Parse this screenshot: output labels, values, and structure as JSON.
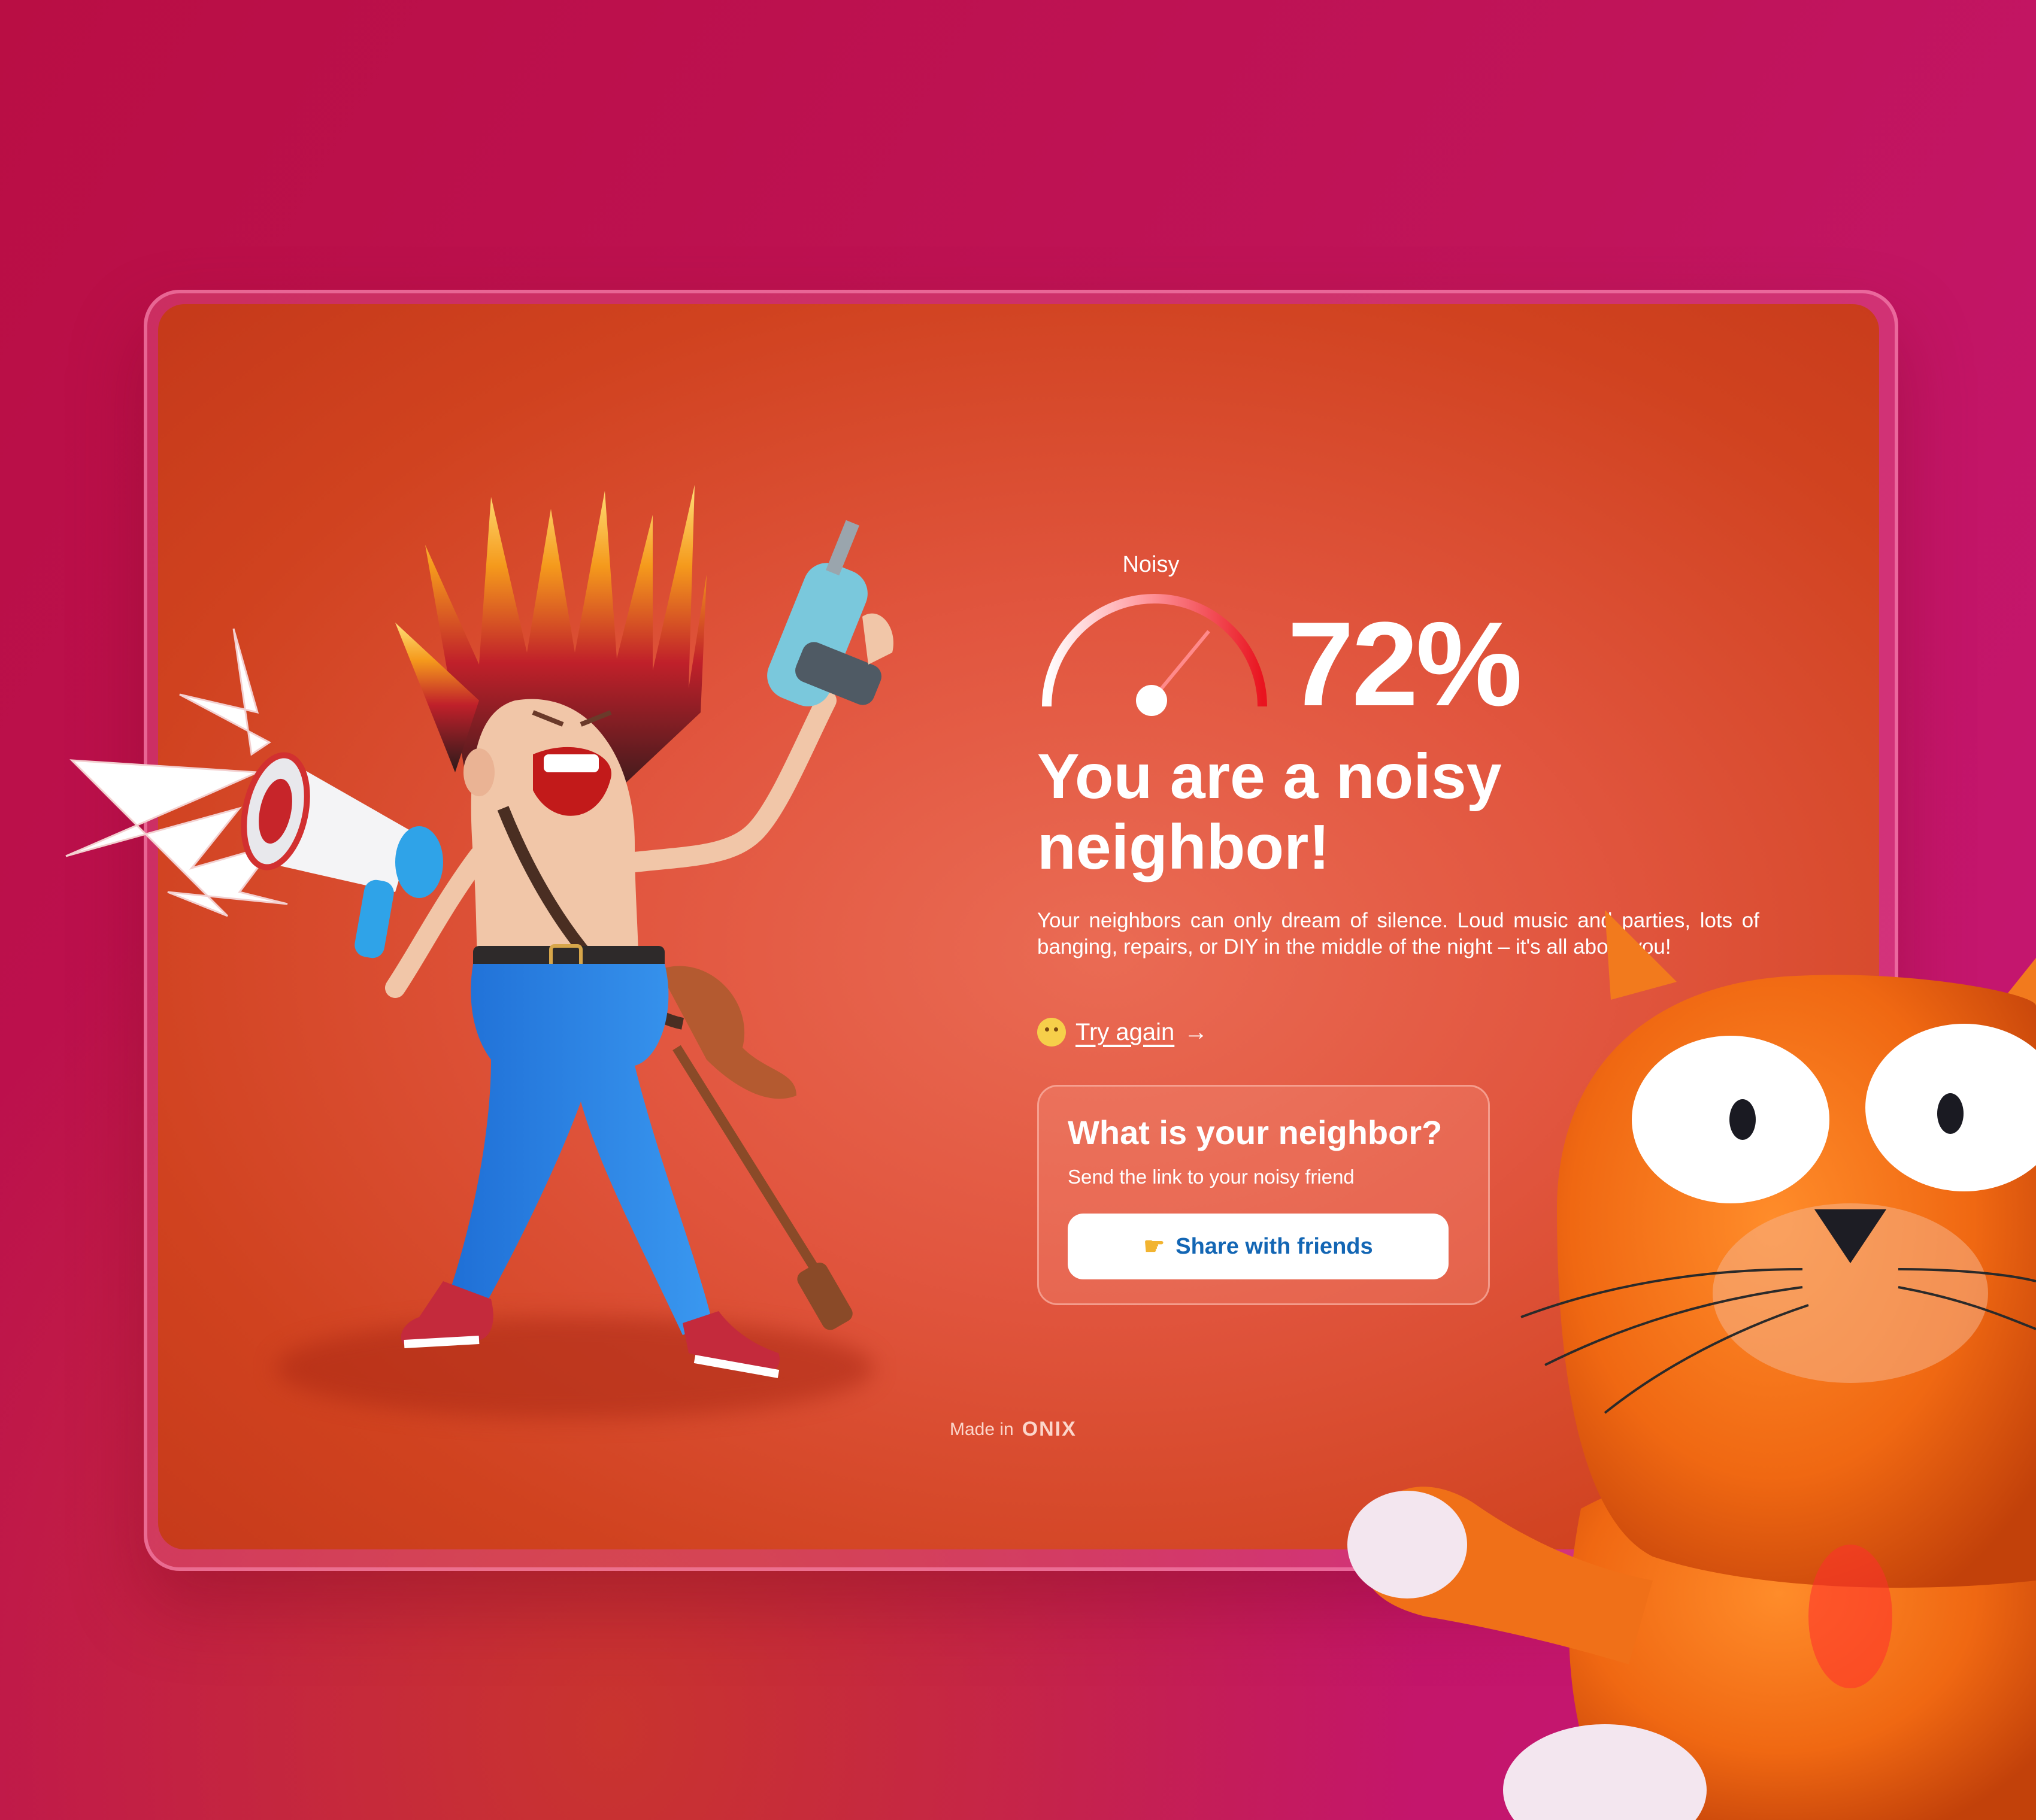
{
  "result": {
    "gauge_label": "Noisy",
    "percent_text": "72%",
    "noise_level_percent": 72,
    "headline": "You are a noisy neighbor!",
    "description": "Your neighbors can only dream of silence. Loud music and parties, lots of banging, repairs, or DIY in the middle of the night – it's all about you!"
  },
  "try_again": {
    "label": "Try again",
    "arrow": "→",
    "icon": "smiley-emoji-icon"
  },
  "share": {
    "title": "What is your neighbor?",
    "subtitle": "Send the link to your noisy friend",
    "button_label": "Share with friends",
    "button_icon": "pointing-hand-emoji-icon"
  },
  "footer": {
    "made_in": "Made in",
    "brand": "ONIX"
  },
  "colors": {
    "background": "#bd1250",
    "card": "#e1553e",
    "gauge_accent": "#e9141f",
    "button_text": "#1366b4"
  }
}
